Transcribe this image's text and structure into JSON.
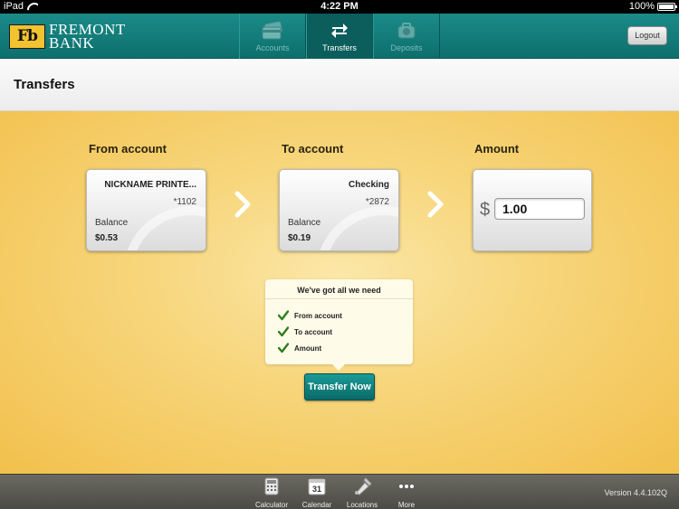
{
  "status_bar": {
    "device": "iPad",
    "time": "4:22 PM",
    "battery": "100%"
  },
  "header": {
    "logo_mark": "Fb",
    "logo_line1": "FREMONT",
    "logo_line2": "BANK",
    "tabs": [
      {
        "label": "Accounts",
        "icon": "accounts-icon",
        "active": false
      },
      {
        "label": "Transfers",
        "icon": "transfers-icon",
        "active": true
      },
      {
        "label": "Deposits",
        "icon": "deposits-icon",
        "active": false
      }
    ],
    "logout_label": "Logout"
  },
  "page": {
    "title": "Transfers"
  },
  "transfer": {
    "from_label": "From account",
    "to_label": "To account",
    "amount_label": "Amount",
    "from_account": {
      "name": "NICKNAME PRINTE...",
      "number": "*1102",
      "balance_label": "Balance",
      "balance": "$0.53"
    },
    "to_account": {
      "name": "Checking",
      "number": "*2872",
      "balance_label": "Balance",
      "balance": "$0.19"
    },
    "currency_symbol": "$",
    "amount_value": "1.00"
  },
  "checklist": {
    "heading": "We've got all we need",
    "items": [
      "From account",
      "To account",
      "Amount"
    ],
    "check_color": "#2e7d1f"
  },
  "transfer_button_label": "Transfer Now",
  "bottom_bar": {
    "tools": [
      {
        "label": "Calculator",
        "icon": "calculator-icon"
      },
      {
        "label": "Calendar",
        "icon": "calendar-icon",
        "badge": "31"
      },
      {
        "label": "Locations",
        "icon": "locations-icon"
      },
      {
        "label": "More",
        "icon": "more-icon"
      }
    ],
    "version": "Version 4.4.102Q"
  }
}
